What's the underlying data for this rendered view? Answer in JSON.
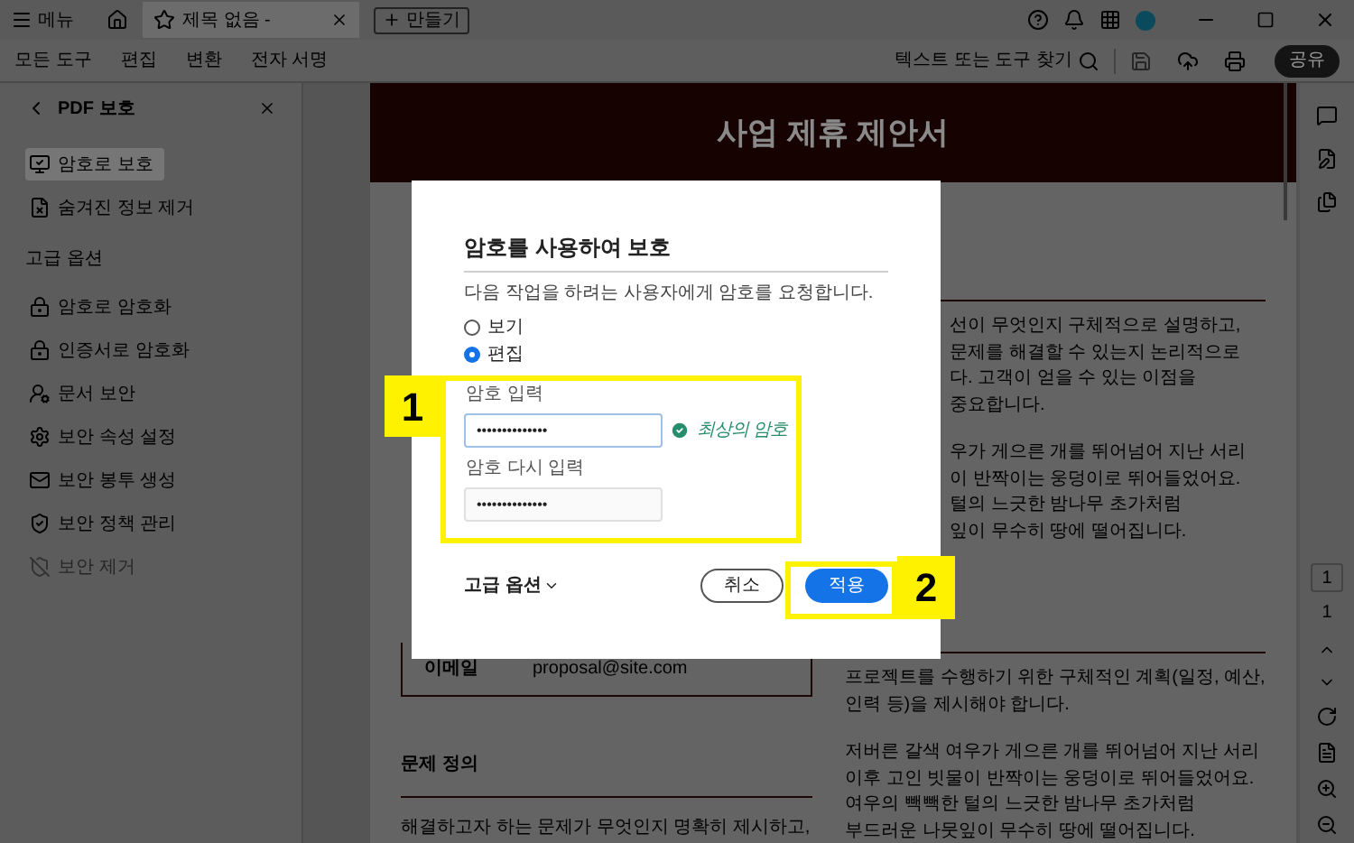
{
  "title_bar": {
    "menu_label": "메뉴",
    "tabs": [
      {
        "label": "제목 없음 -",
        "selected": true
      }
    ],
    "new_button": "만들기"
  },
  "toolbar": {
    "menu": [
      {
        "label": "모든 도구"
      },
      {
        "label": "편집"
      },
      {
        "label": "변환"
      },
      {
        "label": "전자 서명"
      }
    ],
    "search": {
      "placeholder": "텍스트 또는 도구 찾기"
    },
    "share_button": "공유"
  },
  "sidebar": {
    "title": "PDF 보호",
    "items": [
      {
        "label": "암호로 보호",
        "selected": true
      },
      {
        "label": "숨겨진 정보 제거",
        "selected": false
      }
    ],
    "section": "고급 옵션",
    "advanced_items": [
      {
        "label": "암호로 암호화",
        "disabled": false
      },
      {
        "label": "인증서로 암호화",
        "disabled": false
      },
      {
        "label": "문서 보안",
        "disabled": false
      },
      {
        "label": "보안 속성 설정",
        "disabled": false
      },
      {
        "label": "보안 봉투 생성",
        "disabled": false
      },
      {
        "label": "보안 정책 관리",
        "disabled": false
      },
      {
        "label": "보안 제거",
        "disabled": true
      }
    ]
  },
  "document": {
    "title": "사업 제휴 제안서",
    "contact": {
      "label": "이메일",
      "value": "proposal@site.com"
    },
    "heading": "문제 정의",
    "left_paragraph": "해결하고자 하는 문제가 무엇인지 명확히 제시하고,",
    "right_top_paragraphs": [
      [
        "선이 무엇인지 구체적으로 설명하고,",
        "문제를 해결할 수 있는지 논리적으로",
        "다. 고객이 얻을 수 있는 이점을",
        "중요합니다."
      ],
      [
        "우가 게으른 개를 뛰어넘어 지난 서리",
        "이 반짝이는 웅덩이로 뛰어들었어요.",
        "털의 느긋한 밤나무 초가처럼",
        "잎이 무수히 땅에 떨어집니다."
      ]
    ],
    "right_bottom_paragraphs": [
      [
        "프로젝트를 수행하기 위한 구체적인 계획(일정, 예산,",
        "인력 등)을 제시해야 합니다."
      ],
      [
        "저버른 갈색 여우가 게으른 개를 뛰어넘어 지난 서리",
        "이후 고인 빗물이 반짝이는 웅덩이로 뛰어들었어요.",
        "여우의 빽빽한 털의 느긋한 밤나무 초가처럼",
        "부드러운 나뭇잎이 무수히 땅에 떨어집니다."
      ]
    ]
  },
  "page_nav": {
    "page_box": "1",
    "total": "1"
  },
  "dialog": {
    "title": "암호를 사용하여 보호",
    "description": "다음 작업을 하려는 사용자에게 암호를 요청합니다.",
    "options": [
      {
        "label": "보기",
        "selected": false
      },
      {
        "label": "편집",
        "selected": true
      }
    ],
    "password": {
      "label": "암호 입력",
      "value": "••••••••••••••",
      "strength": "최상의 암호"
    },
    "confirm": {
      "label": "암호 다시 입력",
      "value": "••••••••••••••"
    },
    "advanced": "고급 옵션",
    "buttons": [
      {
        "label": "취소",
        "kind": "secondary"
      },
      {
        "label": "적용",
        "kind": "primary"
      }
    ]
  },
  "annotations": [
    {
      "label": "1"
    },
    {
      "label": "2"
    }
  ]
}
